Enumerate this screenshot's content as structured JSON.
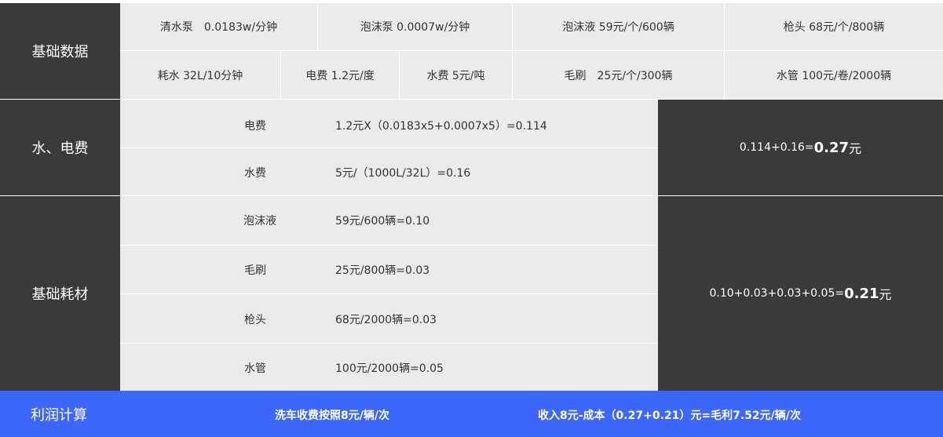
{
  "basic_data": {
    "label": "基础数据",
    "row1": [
      "清水泵　0.0183w/分钟",
      "泡沫泵 0.0007w/分钟",
      "泡沫液 59元/个/600辆",
      "枪头 68元/个/800辆"
    ],
    "row2": [
      "耗水 32L/10分钟",
      "电费 1.2元/度",
      "水费 5元/吨",
      "毛刷　25元/个/300辆",
      "水管 100元/卷/2000辆"
    ]
  },
  "water_power": {
    "label": "水、电费",
    "rows": [
      {
        "name": "电费",
        "formula": "1.2元X（0.0183x5+0.0007x5）=0.114"
      },
      {
        "name": "水费",
        "formula": "5元/（1000L/32L）=0.16"
      }
    ],
    "total_prefix": "0.114+0.16=",
    "total_value": "0.27",
    "total_unit": "元"
  },
  "consumables": {
    "label": "基础耗材",
    "rows": [
      {
        "name": "泡沫液",
        "formula": "59元/600辆=0.10"
      },
      {
        "name": "毛刷",
        "formula": "25元/800辆=0.03"
      },
      {
        "name": "枪头",
        "formula": "68元/2000辆=0.03"
      },
      {
        "name": "水管",
        "formula": "100元/2000辆=0.05"
      }
    ],
    "total_prefix": "0.10+0.03+0.03+0.05=",
    "total_value": "0.21",
    "total_unit": "元"
  },
  "profit": {
    "label": "利润计算",
    "charge": "洗车收费按照8元/辆/次",
    "result": "收入8元-成本（0.27+0.21）元=毛利7.52元/辆/次"
  },
  "colors": {
    "dark": "#3a3a3a",
    "light": "#ebebeb",
    "blue": "#3d66fb"
  }
}
